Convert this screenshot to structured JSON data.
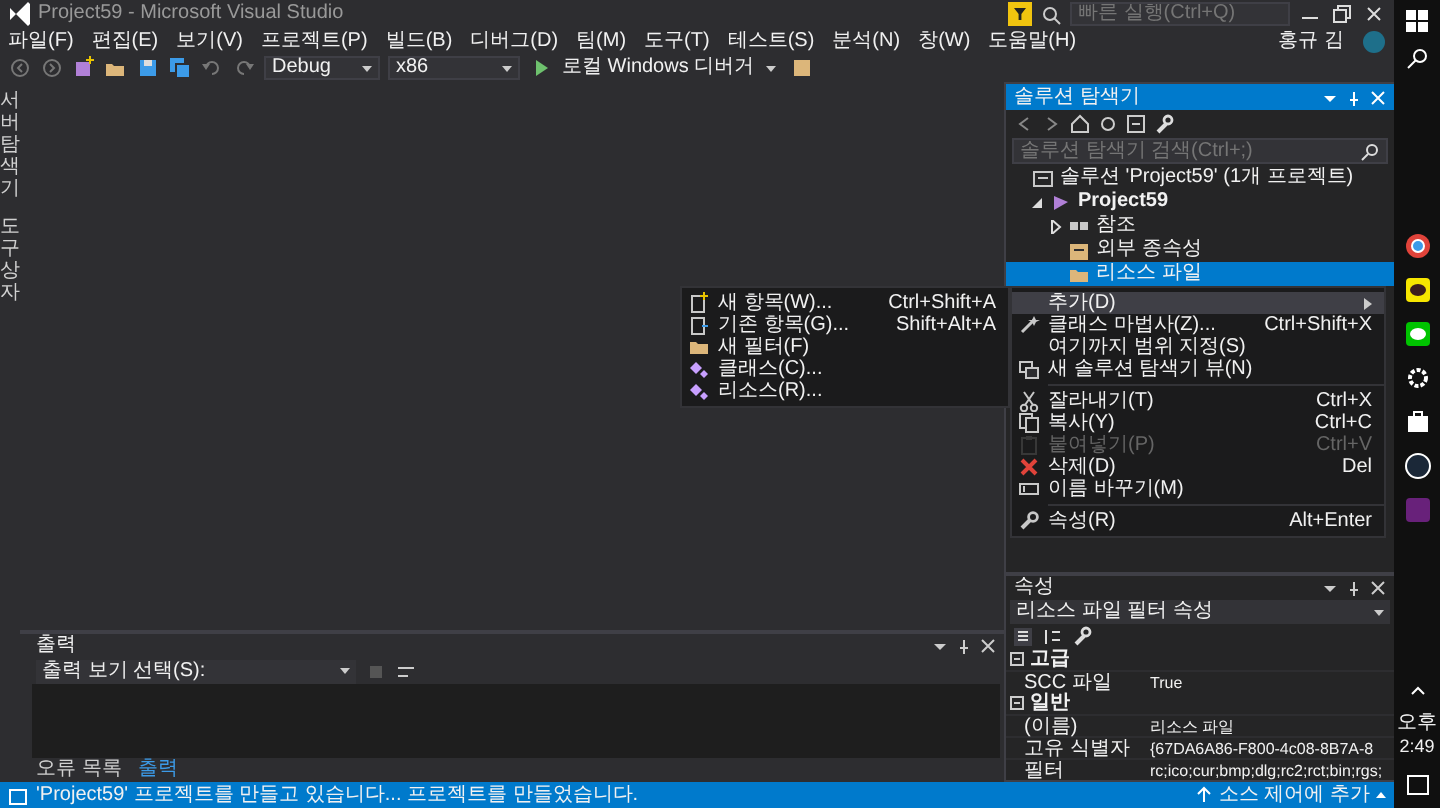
{
  "window": {
    "title": "Project59 - Microsoft Visual Studio"
  },
  "quick_launch": {
    "placeholder": "빠른 실행(Ctrl+Q)"
  },
  "account": {
    "name": "홍규 김"
  },
  "menu_bar": [
    "파일(F)",
    "편집(E)",
    "보기(V)",
    "프로젝트(P)",
    "빌드(B)",
    "디버그(D)",
    "팀(M)",
    "도구(T)",
    "테스트(S)",
    "분석(N)",
    "창(W)",
    "도움말(H)"
  ],
  "toolbar": {
    "configuration": "Debug",
    "platform": "x86",
    "debugger": "로컬 Windows 디버거"
  },
  "side_tabs": [
    "서버 탐색기",
    "도구 상자"
  ],
  "solution_explorer": {
    "title": "솔루션 탐색기",
    "search": {
      "placeholder": "솔루션 탐색기 검색(Ctrl+;)"
    },
    "tree": [
      {
        "label": "솔루션 'Project59' (1개 프로젝트)",
        "kind": "solution",
        "selected": false,
        "children": [
          {
            "label": "Project59",
            "kind": "project",
            "expanded": true,
            "selected": false,
            "children": [
              {
                "label": "참조",
                "kind": "references",
                "expanded": false,
                "selected": false
              },
              {
                "label": "외부 종속성",
                "kind": "dependencies",
                "selected": false
              },
              {
                "label": "리소스 파일",
                "kind": "filter",
                "selected": true
              }
            ]
          }
        ]
      }
    ]
  },
  "context_menu": {
    "items": [
      {
        "kind": "item",
        "label": "추가(D)",
        "submenu": true,
        "selected": true,
        "disabled": false
      },
      {
        "kind": "item",
        "label": "클래스 마법사(Z)...",
        "shortcut": "Ctrl+Shift+X",
        "selected": false,
        "disabled": false
      },
      {
        "kind": "item",
        "label": "여기까지 범위 지정(S)",
        "selected": false,
        "disabled": false
      },
      {
        "kind": "item",
        "label": "새 솔루션 탐색기 뷰(N)",
        "selected": false,
        "disabled": false
      },
      {
        "kind": "separator"
      },
      {
        "kind": "item",
        "label": "잘라내기(T)",
        "shortcut": "Ctrl+X",
        "selected": false,
        "disabled": false
      },
      {
        "kind": "item",
        "label": "복사(Y)",
        "shortcut": "Ctrl+C",
        "selected": false,
        "disabled": false
      },
      {
        "kind": "item",
        "label": "붙여넣기(P)",
        "shortcut": "Ctrl+V",
        "selected": false,
        "disabled": true
      },
      {
        "kind": "item",
        "label": "삭제(D)",
        "shortcut": "Del",
        "selected": false,
        "disabled": false
      },
      {
        "kind": "item",
        "label": "이름 바꾸기(M)",
        "selected": false,
        "disabled": false
      },
      {
        "kind": "separator"
      },
      {
        "kind": "item",
        "label": "속성(R)",
        "shortcut": "Alt+Enter",
        "selected": false,
        "disabled": false
      }
    ]
  },
  "submenu": {
    "items": [
      {
        "label": "새 항목(W)...",
        "shortcut": "Ctrl+Shift+A"
      },
      {
        "label": "기존 항목(G)...",
        "shortcut": "Shift+Alt+A"
      },
      {
        "label": "새 필터(F)"
      },
      {
        "label": "클래스(C)..."
      },
      {
        "label": "리소스(R)..."
      }
    ]
  },
  "properties": {
    "title": "속성",
    "object": "리소스 파일 필터 속성",
    "categories": [
      {
        "name": "고급",
        "expanded": true,
        "rows": [
          {
            "name": "SCC 파일",
            "value": "True"
          }
        ]
      },
      {
        "name": "일반",
        "expanded": true,
        "rows": [
          {
            "name": "(이름)",
            "value": "리소스 파일"
          },
          {
            "name": "고유 식별자",
            "value": "{67DA6A86-F800-4c08-8B7A-8"
          },
          {
            "name": "필터",
            "value": "rc;ico;cur;bmp;dlg;rc2;rct;bin;rgs;"
          }
        ]
      }
    ]
  },
  "output": {
    "title": "출력",
    "source_label": "출력 보기 선택(S):",
    "tabs": [
      {
        "label": "오류 목록",
        "selected": false
      },
      {
        "label": "출력",
        "selected": true
      }
    ]
  },
  "status_bar": {
    "message": "'Project59' 프로젝트를 만들고 있습니다... 프로젝트를 만들었습니다.",
    "source_control": "소스 제어에 추가"
  },
  "taskbar": {
    "time_period": "오후",
    "time": "2:49"
  }
}
